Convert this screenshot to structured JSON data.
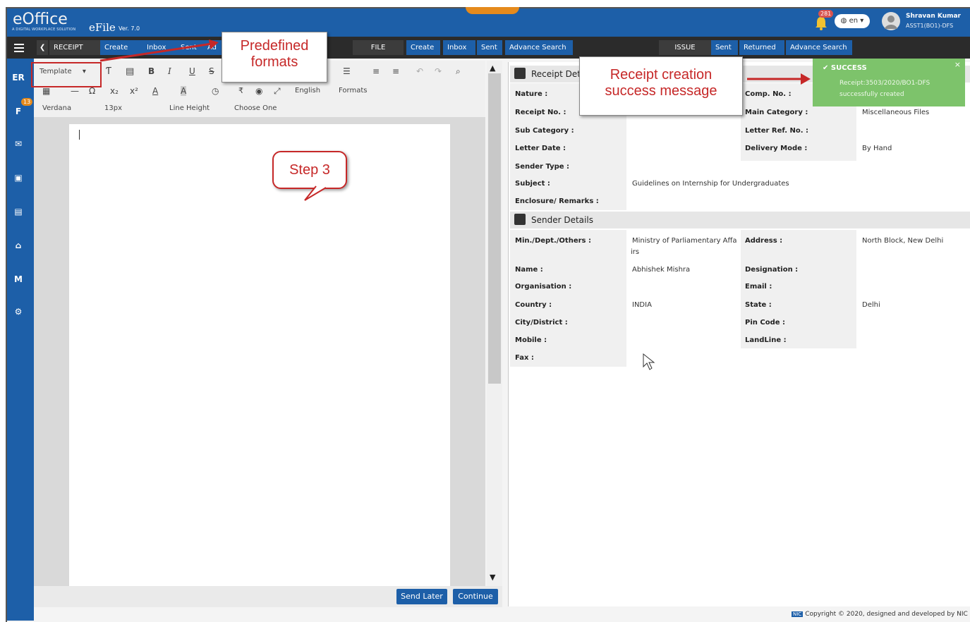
{
  "header": {
    "logo_text": "eOffice",
    "logo_tagline": "A DIGITAL WORKPLACE SOLUTION",
    "product": "eFile",
    "version": "Ver. 7.0",
    "notifications_count": "281",
    "language": "en",
    "user_name": "Shravan Kumar",
    "user_role": "ASST1(BO1)-DFS"
  },
  "nav": {
    "receipt": {
      "label": "RECEIPT",
      "items": [
        "Create",
        "Inbox",
        "Sent",
        "Ad"
      ]
    },
    "file": {
      "label": "FILE",
      "items": [
        "Create",
        "Inbox",
        "Sent",
        "Advance Search"
      ]
    },
    "issue": {
      "label": "ISSUE",
      "items": [
        "Sent",
        "Returned",
        "Advance Search"
      ]
    }
  },
  "sidebar": {
    "badge": "13"
  },
  "editor": {
    "template_select": "Template",
    "font": "Verdana",
    "font_size": "13px",
    "line_height": "Line Height",
    "choose_one": "Choose One",
    "language": "English",
    "formats": "Formats",
    "buttons": {
      "send_later": "Send Later",
      "continue": "Continue"
    }
  },
  "receipt_details": {
    "title": "Receipt Det",
    "fields": {
      "nature": "Nature :",
      "comp_no": "Comp. No. :",
      "receipt_no": "Receipt No. :",
      "main_category": "Main Category :",
      "main_category_value": "Miscellaneous Files",
      "sub_category": "Sub Category :",
      "letter_ref_no": "Letter Ref. No. :",
      "letter_date": "Letter Date :",
      "delivery_mode": "Delivery Mode :",
      "delivery_mode_value": "By Hand",
      "sender_type": "Sender Type :",
      "subject": "Subject :",
      "subject_value": "Guidelines on Internship for Undergraduates",
      "enclosure": "Enclosure/ Remarks :"
    }
  },
  "sender_details": {
    "title": "Sender Details",
    "fields": {
      "ministry": "Min./Dept./Others :",
      "ministry_value_1": "Ministry of Parliamentary Affa",
      "ministry_value_2": "irs",
      "address": "Address :",
      "address_value": "North Block, New Delhi",
      "name": "Name :",
      "name_value": "Abhishek Mishra",
      "designation": "Designation :",
      "organisation": "Organisation :",
      "email": "Email :",
      "country": "Country :",
      "country_value": "INDIA",
      "state": "State :",
      "state_value": "Delhi",
      "city": "City/District :",
      "pin_code": "Pin Code :",
      "mobile": "Mobile :",
      "landline": "LandLine :",
      "fax": "Fax :"
    }
  },
  "toast": {
    "title": "SUCCESS",
    "message_1": "Receipt:3503/2020/BO1-DFS",
    "message_2": "successfully created",
    "close": "×"
  },
  "annotations": {
    "predefined_1": "Predefined",
    "predefined_2": "formats",
    "receipt_msg_1": "Receipt creation",
    "receipt_msg_2": "success message",
    "step3": "Step 3"
  },
  "footer": {
    "nic": "NIC",
    "copyright": "Copyright © 2020, designed and developed by NIC"
  },
  "colors": {
    "header_blue": "#1d5fa8",
    "accent_orange": "#e58a1c",
    "callout_red": "#c62828",
    "success_green": "#7dc36b"
  }
}
